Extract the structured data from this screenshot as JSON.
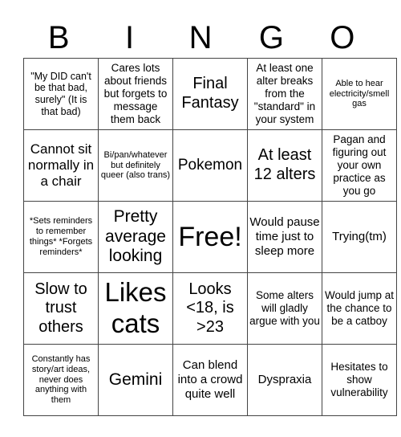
{
  "header": {
    "letters": [
      "B",
      "I",
      "N",
      "G",
      "O"
    ]
  },
  "board": {
    "rows": [
      [
        "\"My DID can't be that bad, surely\" (It is that bad)",
        "Cares lots about friends but forgets to message them back",
        "Final Fantasy",
        "At least one alter breaks from the \"standard\" in your system",
        "Able to hear electricity/smell gas"
      ],
      [
        "Cannot sit normally in a chair",
        "Bi/pan/whatever but definitely queer (also trans)",
        "Pokemon",
        "At least 12 alters",
        "Pagan and figuring out your own practice as you go"
      ],
      [
        "*Sets reminders to remember things* *Forgets reminders*",
        "Pretty average looking",
        "Free!",
        "Would pause time just to sleep more",
        "Trying(tm)"
      ],
      [
        "Slow to trust others",
        "Likes cats",
        "Looks <18, is >23",
        "Some alters will gladly argue with you",
        "Would jump at the chance to be a catboy"
      ],
      [
        "Constantly has story/art ideas, never does anything with them",
        "Gemini",
        "Can blend into a crowd quite well",
        "Dyspraxia",
        "Hesitates to show vulnerability"
      ]
    ],
    "free_space": {
      "row": 2,
      "col": 2,
      "label": "Free!"
    }
  }
}
